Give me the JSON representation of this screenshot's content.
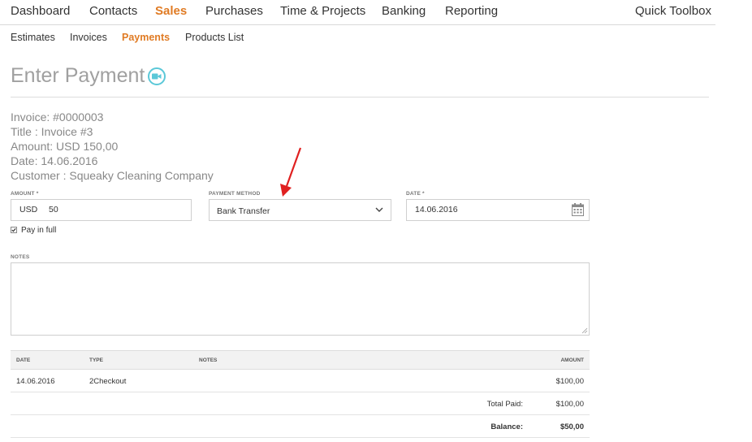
{
  "nav": {
    "items": [
      "Dashboard",
      "Contacts",
      "Sales",
      "Purchases",
      "Time & Projects",
      "Banking",
      "Reporting"
    ],
    "active": "Sales",
    "quick_toolbox": "Quick Toolbox"
  },
  "subnav": {
    "items": [
      "Estimates",
      "Invoices",
      "Payments",
      "Products List"
    ],
    "active": "Payments"
  },
  "page": {
    "title": "Enter Payment"
  },
  "invoice": {
    "number": "Invoice: #0000003",
    "title": "Title : Invoice #3",
    "amount": "Amount: USD 150,00",
    "date": "Date: 14.06.2016",
    "customer": "Customer : Squeaky Cleaning Company"
  },
  "form": {
    "amount_label": "AMOUNT *",
    "currency": "USD",
    "amount_value": "50",
    "payment_method_label": "PAYMENT METHOD",
    "payment_method_value": "Bank Transfer",
    "date_label": "DATE *",
    "date_value": "14.06.2016",
    "pay_in_full_label": "Pay in full",
    "pay_in_full_checked": true,
    "notes_label": "NOTES",
    "notes_value": ""
  },
  "payments_table": {
    "headers": {
      "date": "DATE",
      "type": "TYPE",
      "notes": "NOTES",
      "amount": "AMOUNT"
    },
    "rows": [
      {
        "date": "14.06.2016",
        "type": "2Checkout",
        "notes": "",
        "amount": "$100,00"
      }
    ],
    "total_paid_label": "Total Paid:",
    "total_paid_value": "$100,00",
    "balance_label": "Balance:",
    "balance_value": "$50,00"
  },
  "colors": {
    "accent": "#e07b24",
    "video_icon": "#5bc8d8",
    "annotation_arrow": "#e02020"
  }
}
